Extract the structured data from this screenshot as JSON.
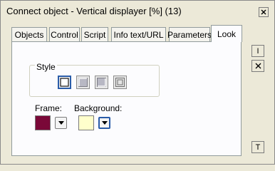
{
  "window": {
    "title": "Connect object - Vertical displayer [%] (13)"
  },
  "tabs": [
    {
      "label": "Objects"
    },
    {
      "label": "Control"
    },
    {
      "label": "Script"
    },
    {
      "label": "Info text/URL"
    },
    {
      "label": "Parameters"
    },
    {
      "label": "Look",
      "active": true
    }
  ],
  "look": {
    "style_label": "Style",
    "style_options": [
      "flat",
      "raised",
      "sunken",
      "etched"
    ],
    "selected_style": "flat",
    "frame_label": "Frame:",
    "frame_color": "#7a0838",
    "background_label": "Background:",
    "background_color": "#ffffcc"
  },
  "side_buttons": [
    {
      "icon": "insert-icon",
      "label": "I"
    },
    {
      "icon": "delete-icon",
      "label": "X"
    },
    {
      "icon": "text-icon",
      "label": "T"
    }
  ],
  "colors": {
    "accent": "#2a5ca8",
    "panel_bg": "#fcfcfe",
    "window_bg": "#ece9d8"
  }
}
